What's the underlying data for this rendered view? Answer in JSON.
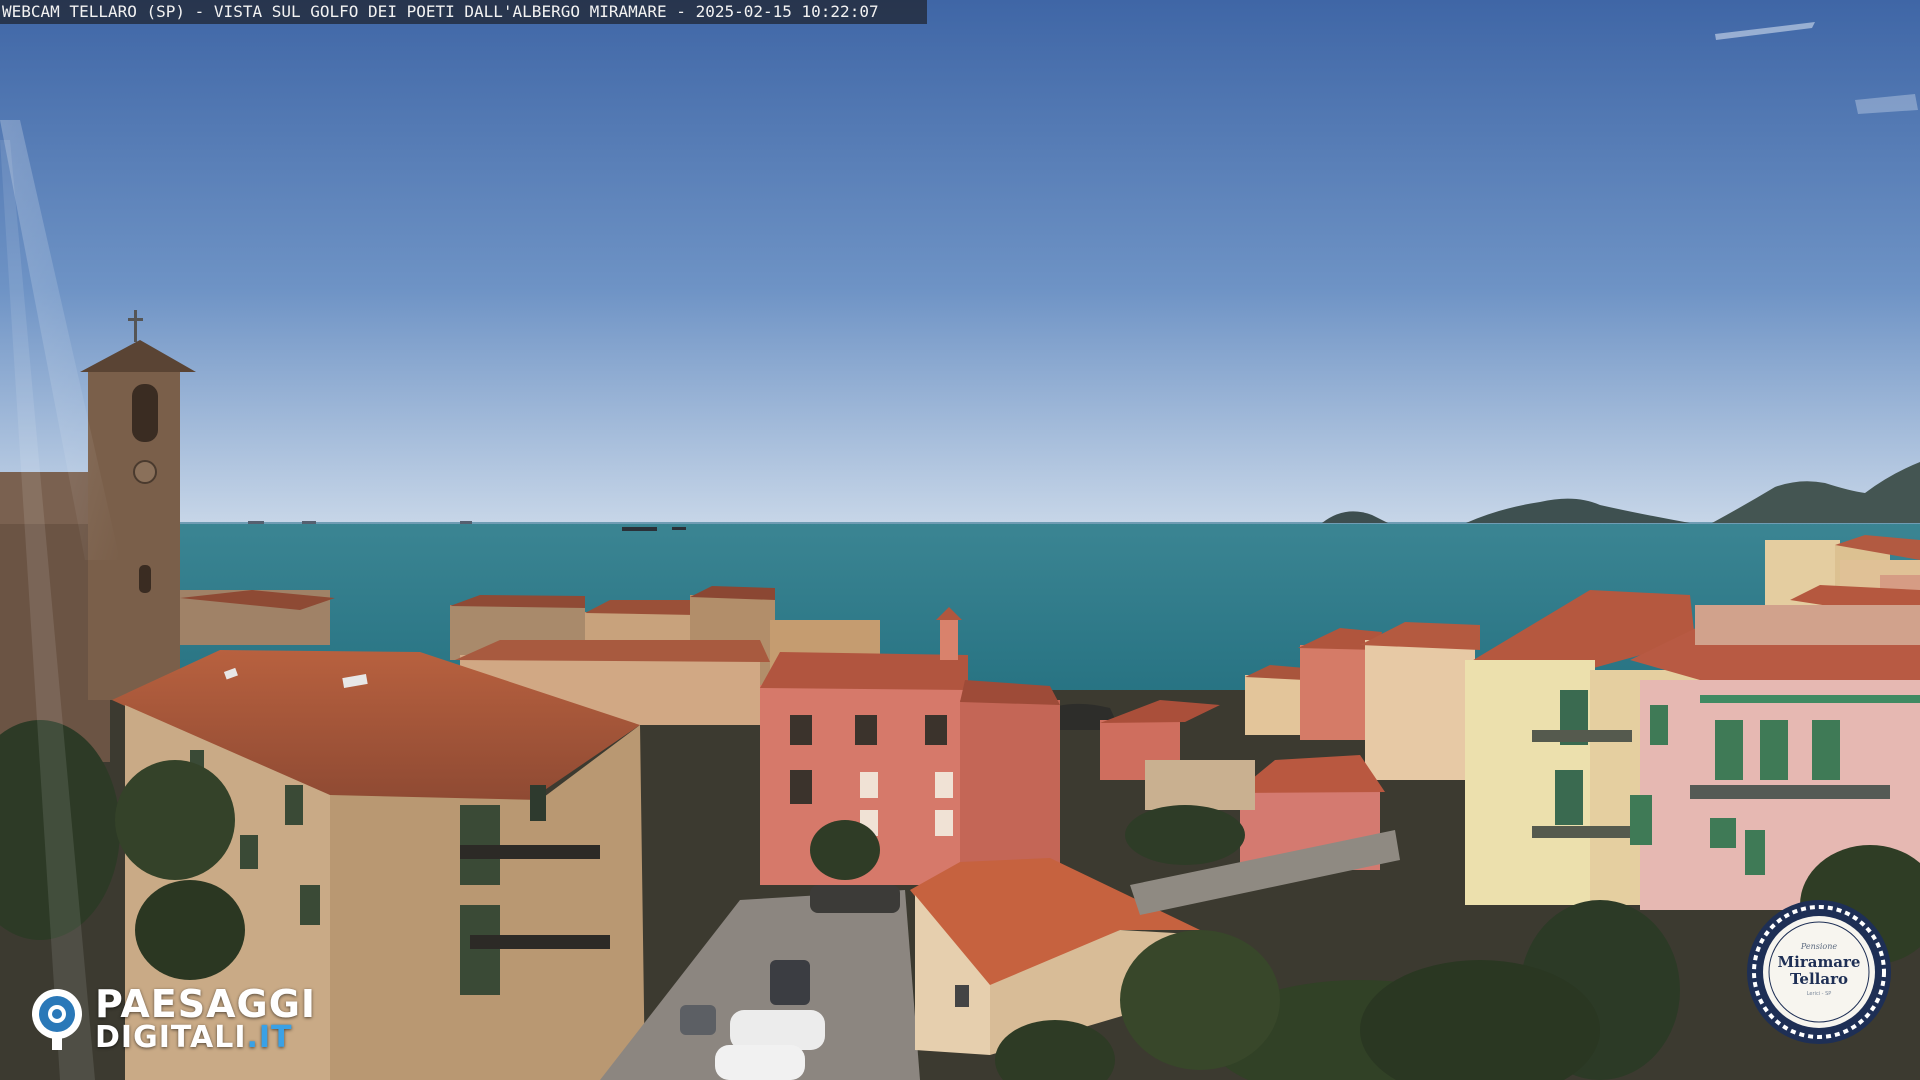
{
  "overlay": {
    "caption": "WEBCAM TELLARO (SP) - VISTA SUL GOLFO DEI POETI DALL'ALBERGO MIRAMARE - 2025-02-15 10:22:07"
  },
  "watermark_left": {
    "line1": "PAESAGGI",
    "line2_main": "DIGITALI",
    "line2_tld": ".IT"
  },
  "badge": {
    "small": "Pensione",
    "name_line1": "Miramare",
    "name_line2": "Tellaro",
    "footer": "Lerici - SP"
  },
  "colors": {
    "sky_top": "#4169a8",
    "sky_horizon": "#c9d6e6",
    "sea": "#2e7d8a",
    "roof": "#b05a3e",
    "accent_blue": "#3aa1e6",
    "badge_navy": "#1e2f55"
  }
}
